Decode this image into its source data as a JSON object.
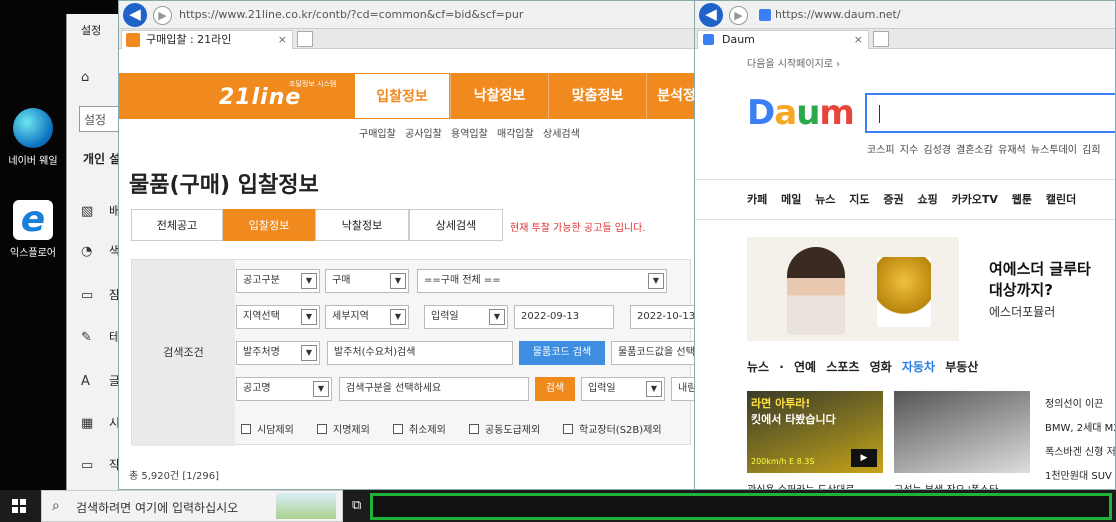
{
  "desktop": {
    "icons": [
      {
        "label": "네이버 웨일",
        "icon": "naver-whale-icon"
      },
      {
        "label": "익스플로어",
        "icon": "internet-explorer-icon"
      }
    ]
  },
  "settings": {
    "title": "설정",
    "search_placeholder": "설정",
    "section": "개인 설",
    "items": [
      "배",
      "색",
      "잠",
      "테",
      "글",
      "시",
      "작"
    ]
  },
  "line21": {
    "url": "https://www.21line.co.kr/contb/?cd=common&cf=bid&scf=pur",
    "tab_title": "구매입찰 : 21라인",
    "logo": "21line",
    "logo_tagline": "조달정보 시스템",
    "nav": [
      "입찰정보",
      "낙찰정보",
      "맞춤정보",
      "분석정"
    ],
    "subnav": [
      "구매입찰",
      "공사입찰",
      "용역입찰",
      "매각입찰",
      "상세검색"
    ],
    "page_title": "물품(구매) 입찰정보",
    "tabs": [
      "전체공고",
      "입찰정보",
      "낙찰정보",
      "상세검색"
    ],
    "notice": "현재 투찰 가능한 공고들 입니다.",
    "cond_label": "검색조건",
    "row1": {
      "type": "공고구분",
      "kind": "구매",
      "all": "==구매 전체 =="
    },
    "row2": {
      "region": "지역선택",
      "sub": "세부지역",
      "date_type": "입력일",
      "from": "2022-09-13",
      "tilde": "~",
      "to": "2022-10-13"
    },
    "row3": {
      "field": "발주처명",
      "value": "발주처(수요처)검색",
      "btn": "물품코드 검색",
      "hint": "물품코드값을 선택"
    },
    "row4": {
      "field": "공고명",
      "value": "검색구분을 선택하세요",
      "btn": "검색",
      "date": "입력일",
      "more": "내림"
    },
    "checks": [
      "시담제외",
      "지명제외",
      "취소제외",
      "공동도급제외",
      "학교장터(S2B)제외"
    ],
    "total": "총 5,920건 [1/296]"
  },
  "daum": {
    "url": "https://www.daum.net/",
    "tab_title": "Daum",
    "start_page": "다음을 시작페이지로 ›",
    "logo": "Daum",
    "trends": [
      "코스피 지수",
      "김성경 결혼소감",
      "유재석 뉴스투데이",
      "김희"
    ],
    "menu": [
      "카페",
      "메일",
      "뉴스",
      "지도",
      "증권",
      "쇼핑",
      "카카오TV",
      "웹툰",
      "캘린더"
    ],
    "ad_title": [
      "여에스더 글루타",
      "대상까지?"
    ],
    "ad_sub": "에스더포뮬러",
    "categories": [
      "뉴스 ·",
      "연예",
      "스포츠",
      "영화",
      "자동차",
      "부동산"
    ],
    "active_category": "자동차",
    "thumb1_caption": "관심용 슈퍼카는 도산대로",
    "thumb2_caption": "고성능 부생 잔요 '폭스타",
    "thumb1_text": [
      "라면 아투라!",
      "킷에서 타봤습니다",
      "200km/h E 8.3S"
    ],
    "news_list": [
      "정의선이 이끈",
      "BMW, 2세대 M2",
      "폭스바겐 신형 저",
      "1천만원대 SUV"
    ]
  },
  "taskbar": {
    "search_placeholder": "검색하려면 여기에 입력하십시오"
  }
}
